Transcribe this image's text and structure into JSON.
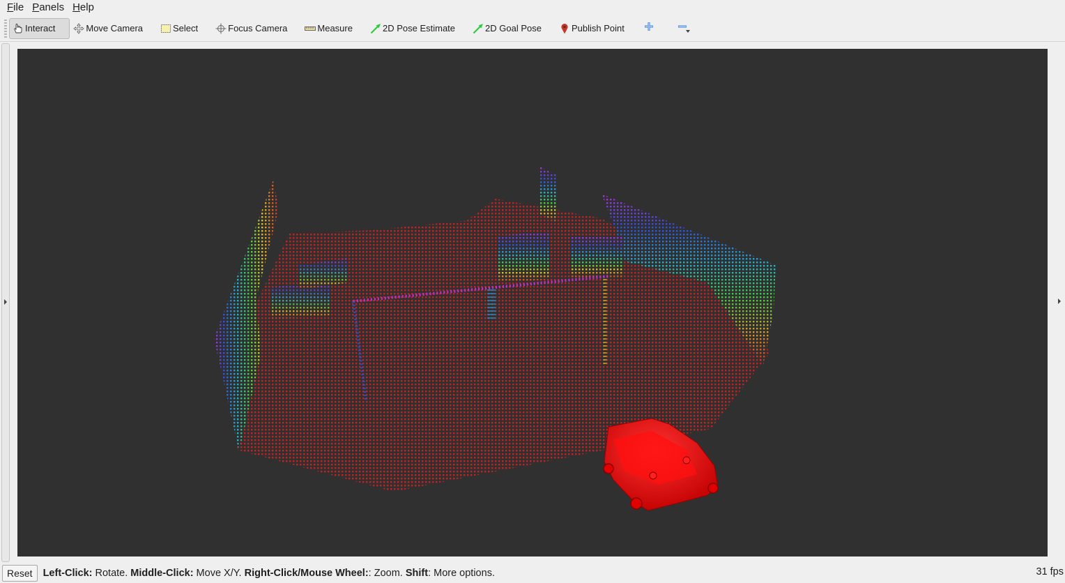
{
  "menu": {
    "file": {
      "first": "F",
      "rest": "ile"
    },
    "panels": {
      "first": "P",
      "rest": "anels"
    },
    "help": {
      "first": "H",
      "rest": "elp"
    }
  },
  "toolbar": {
    "tools": [
      {
        "label": "Interact",
        "icon": "hand-cursor-icon",
        "active": true
      },
      {
        "label": "Move Camera",
        "icon": "move-camera-icon"
      },
      {
        "label": "Select",
        "icon": "select-rect-icon"
      },
      {
        "label": "Focus Camera",
        "icon": "focus-crosshair-icon"
      },
      {
        "label": "Measure",
        "icon": "ruler-icon"
      },
      {
        "label": "2D Pose Estimate",
        "icon": "green-arrow-icon"
      },
      {
        "label": "2D Goal Pose",
        "icon": "green-arrow-icon"
      },
      {
        "label": "Publish Point",
        "icon": "map-pin-icon"
      }
    ],
    "add_icon": "plus-icon",
    "remove_icon": "minus-icon"
  },
  "colors": {
    "viewport_bg": "#303030",
    "floor_points": "#d42020",
    "robot": "#ff0000",
    "toolbar_bg": "#efefef"
  },
  "status": {
    "reset_label": "Reset",
    "hint": [
      {
        "bold": "Left-Click:",
        "text": " Rotate. "
      },
      {
        "bold": "Middle-Click:",
        "text": " Move X/Y. "
      },
      {
        "bold": "Right-Click/Mouse Wheel:",
        "text": ": Zoom. "
      },
      {
        "bold": "Shift",
        "text": ": More options."
      }
    ],
    "fps": "31 fps"
  }
}
